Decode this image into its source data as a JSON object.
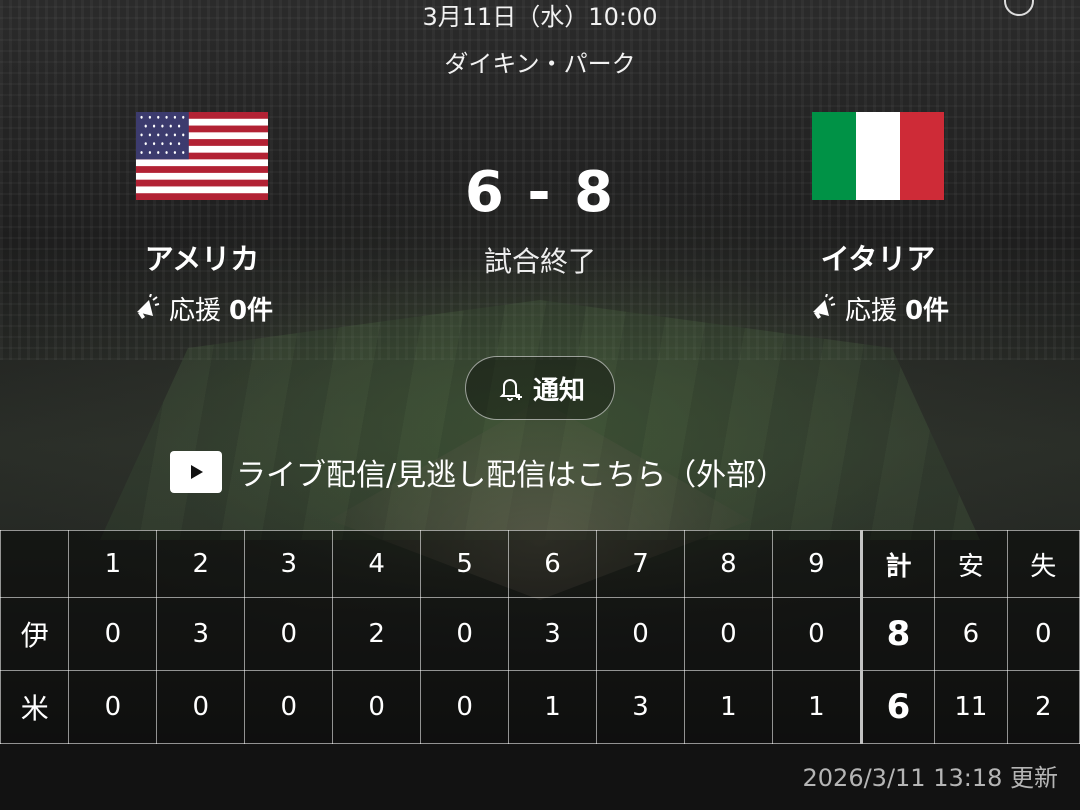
{
  "header": {
    "datetime": "3月11日（水）10:00",
    "venue": "ダイキン・パーク"
  },
  "home_team": {
    "name": "アメリカ",
    "cheer_label": "応援",
    "cheer_count": "0件",
    "flag_icon": "us-flag-icon"
  },
  "away_team": {
    "name": "イタリア",
    "cheer_label": "応援",
    "cheer_count": "0件",
    "flag_icon": "italy-flag-icon"
  },
  "score": {
    "display": "6 - 8",
    "status": "試合終了"
  },
  "notify_button": {
    "label": "通知"
  },
  "live_link": {
    "label": "ライブ配信/見逃し配信はこちら（外部）"
  },
  "scoreboard": {
    "innings": [
      "1",
      "2",
      "3",
      "4",
      "5",
      "6",
      "7",
      "8",
      "9"
    ],
    "total_label": "計",
    "hits_label": "安",
    "errors_label": "失",
    "rows": [
      {
        "team": "伊",
        "runs": [
          "0",
          "3",
          "0",
          "2",
          "0",
          "3",
          "0",
          "0",
          "0"
        ],
        "total": "8",
        "hits": "6",
        "errors": "0"
      },
      {
        "team": "米",
        "runs": [
          "0",
          "0",
          "0",
          "0",
          "0",
          "1",
          "3",
          "1",
          "1"
        ],
        "total": "6",
        "hits": "11",
        "errors": "2"
      }
    ]
  },
  "footer": {
    "updated": "2026/3/11 13:18 更新"
  },
  "colors": {
    "background": "#1a1a1a",
    "text": "#ffffff",
    "muted": "#b5b5b5"
  }
}
